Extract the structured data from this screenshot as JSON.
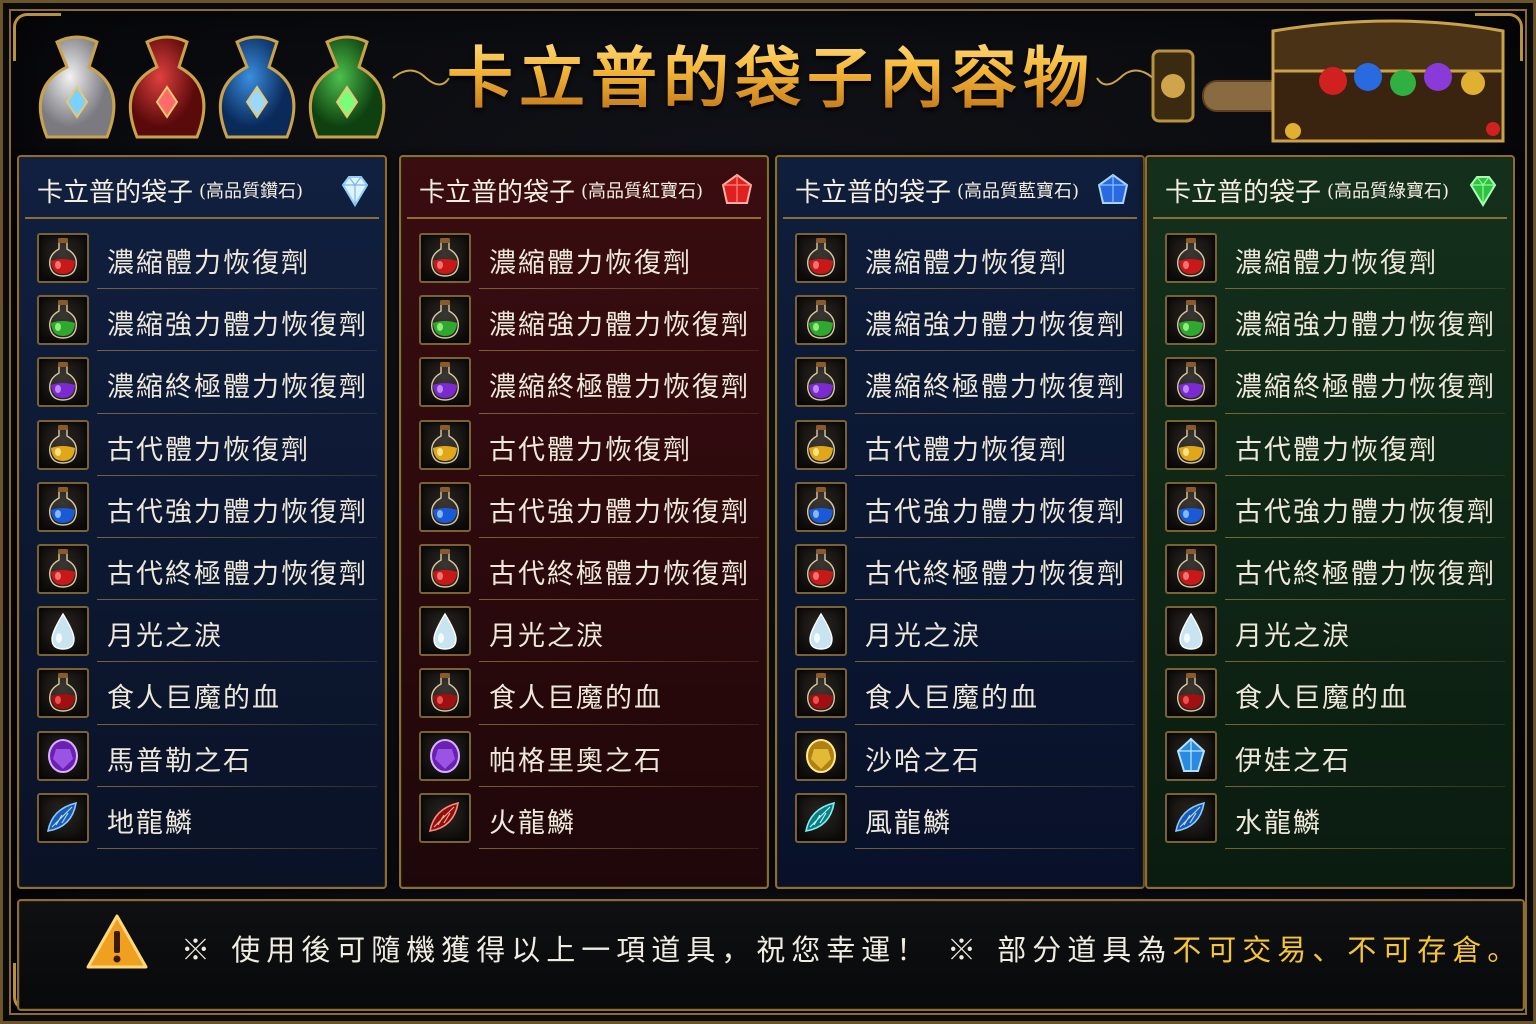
{
  "title": "卡立普的袋子內容物",
  "colors": {
    "title_gold": "#f3b73c",
    "frame_gold": "#8c6e33",
    "highlight_yellow": "#f5c437"
  },
  "columns": [
    {
      "theme": "blue",
      "title": "卡立普的袋子",
      "subtitle": "(高品質鑽石)",
      "gem_icon": "white-diamond-icon",
      "items": [
        {
          "icon": "red-potion-icon",
          "name": "濃縮體力恢復劑"
        },
        {
          "icon": "green-potion-icon",
          "name": "濃縮強力體力恢復劑"
        },
        {
          "icon": "purple-potion-icon",
          "name": "濃縮終極體力恢復劑"
        },
        {
          "icon": "yellow-potion-icon",
          "name": "古代體力恢復劑"
        },
        {
          "icon": "blue-potion-icon",
          "name": "古代強力體力恢復劑"
        },
        {
          "icon": "red-potion-icon",
          "name": "古代終極體力恢復劑"
        },
        {
          "icon": "teardrop-icon",
          "name": "月光之淚"
        },
        {
          "icon": "blood-flask-icon",
          "name": "食人巨魔的血"
        },
        {
          "icon": "purple-stone-icon",
          "name": "馬普勒之石"
        },
        {
          "icon": "blue-scale-icon",
          "name": "地龍鱗"
        }
      ]
    },
    {
      "theme": "red",
      "title": "卡立普的袋子",
      "subtitle": "(高品質紅寶石)",
      "gem_icon": "ruby-icon",
      "items": [
        {
          "icon": "red-potion-icon",
          "name": "濃縮體力恢復劑"
        },
        {
          "icon": "green-potion-icon",
          "name": "濃縮強力體力恢復劑"
        },
        {
          "icon": "purple-potion-icon",
          "name": "濃縮終極體力恢復劑"
        },
        {
          "icon": "yellow-potion-icon",
          "name": "古代體力恢復劑"
        },
        {
          "icon": "blue-potion-icon",
          "name": "古代強力體力恢復劑"
        },
        {
          "icon": "red-potion-icon",
          "name": "古代終極體力恢復劑"
        },
        {
          "icon": "teardrop-icon",
          "name": "月光之淚"
        },
        {
          "icon": "blood-flask-icon",
          "name": "食人巨魔的血"
        },
        {
          "icon": "purple-stone-icon",
          "name": "帕格里奧之石"
        },
        {
          "icon": "red-scale-icon",
          "name": "火龍鱗"
        }
      ]
    },
    {
      "theme": "sky",
      "title": "卡立普的袋子",
      "subtitle": "(高品質藍寶石)",
      "gem_icon": "sapphire-icon",
      "items": [
        {
          "icon": "red-potion-icon",
          "name": "濃縮體力恢復劑"
        },
        {
          "icon": "green-potion-icon",
          "name": "濃縮強力體力恢復劑"
        },
        {
          "icon": "purple-potion-icon",
          "name": "濃縮終極體力恢復劑"
        },
        {
          "icon": "yellow-potion-icon",
          "name": "古代體力恢復劑"
        },
        {
          "icon": "blue-potion-icon",
          "name": "古代強力體力恢復劑"
        },
        {
          "icon": "red-potion-icon",
          "name": "古代終極體力恢復劑"
        },
        {
          "icon": "teardrop-icon",
          "name": "月光之淚"
        },
        {
          "icon": "blood-flask-icon",
          "name": "食人巨魔的血"
        },
        {
          "icon": "gold-stone-icon",
          "name": "沙哈之石"
        },
        {
          "icon": "teal-scale-icon",
          "name": "風龍鱗"
        }
      ]
    },
    {
      "theme": "green",
      "title": "卡立普的袋子",
      "subtitle": "(高品質綠寶石)",
      "gem_icon": "emerald-icon",
      "items": [
        {
          "icon": "red-potion-icon",
          "name": "濃縮體力恢復劑"
        },
        {
          "icon": "green-potion-icon",
          "name": "濃縮強力體力恢復劑"
        },
        {
          "icon": "purple-potion-icon",
          "name": "濃縮終極體力恢復劑"
        },
        {
          "icon": "yellow-potion-icon",
          "name": "古代體力恢復劑"
        },
        {
          "icon": "blue-potion-icon",
          "name": "古代強力體力恢復劑"
        },
        {
          "icon": "red-potion-icon",
          "name": "古代終極體力恢復劑"
        },
        {
          "icon": "teardrop-icon",
          "name": "月光之淚"
        },
        {
          "icon": "blood-flask-icon",
          "name": "食人巨魔的血"
        },
        {
          "icon": "blue-stone-icon",
          "name": "伊娃之石"
        },
        {
          "icon": "blue-scale-icon",
          "name": "水龍鱗"
        }
      ]
    }
  ],
  "footer": {
    "note1": "※ 使用後可隨機獲得以上一項道具，祝您幸運！",
    "note2_prefix": "※ 部分道具為",
    "note2_highlight": "不可交易、不可存倉",
    "note2_suffix": "。",
    "warning_icon": "warning-triangle-icon"
  }
}
